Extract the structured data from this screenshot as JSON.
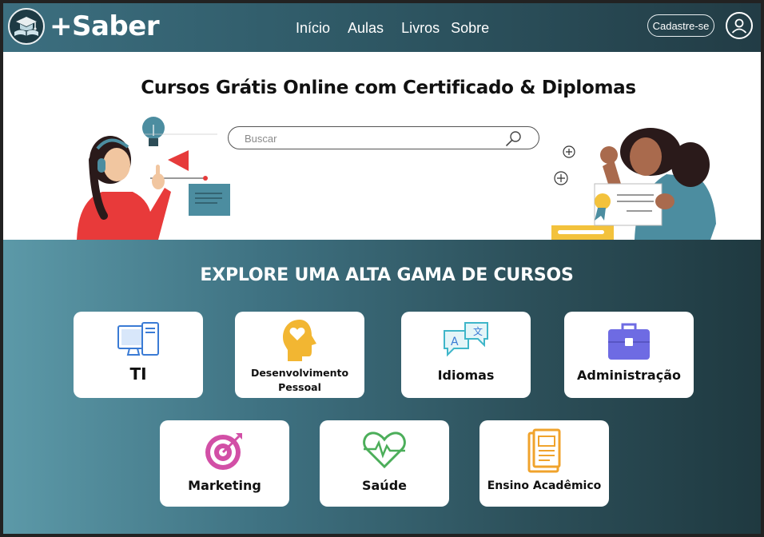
{
  "app": {
    "name": "+Saber"
  },
  "nav": {
    "items": [
      {
        "label": "Início"
      },
      {
        "label": "Aulas"
      },
      {
        "label": "Livros"
      },
      {
        "label": "Sobre"
      }
    ],
    "signup_label": "Cadastre-se",
    "profile_icon": "user-circle-icon"
  },
  "hero": {
    "title": "Cursos Grátis Online com Certificado & Diplomas",
    "search": {
      "placeholder": "Buscar",
      "value": "",
      "icon": "search-icon"
    }
  },
  "courses": {
    "title": "EXPLORE UMA ALTA GAMA DE CURSOS",
    "items": [
      {
        "label": "TI",
        "icon": "computer-icon",
        "color": "#3a7bd5"
      },
      {
        "label": "Desenvolvimento Pessoal",
        "icon": "head-heart-icon",
        "color": "#f2b632"
      },
      {
        "label": "Idiomas",
        "icon": "translate-icon",
        "color": "#3fb6c9"
      },
      {
        "label": "Administração",
        "icon": "briefcase-icon",
        "color": "#6e6be3"
      },
      {
        "label": "Marketing",
        "icon": "target-icon",
        "color": "#d24fa6"
      },
      {
        "label": "Saúde",
        "icon": "heart-pulse-icon",
        "color": "#4cae5a"
      },
      {
        "label": "Ensino Acadêmico",
        "icon": "book-icon",
        "color": "#f0a32c"
      }
    ]
  },
  "colors": {
    "header_start": "#3c6f80",
    "header_end": "#223c45",
    "section_start": "#5c99a8",
    "section_end": "#1f3940"
  }
}
